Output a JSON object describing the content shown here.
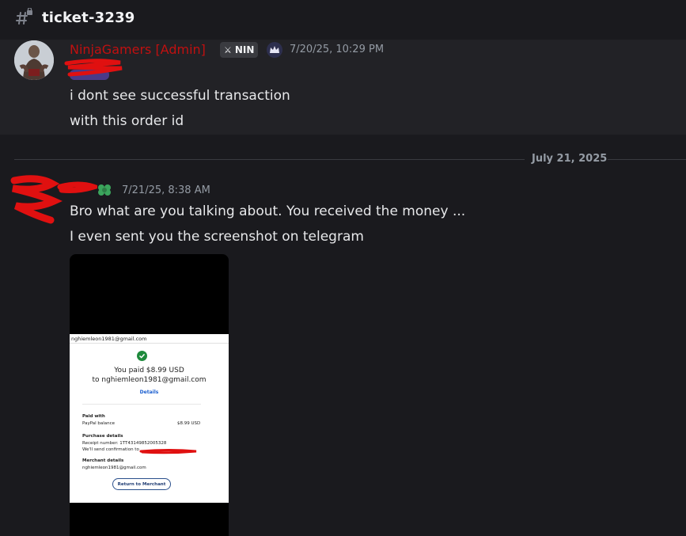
{
  "channel": {
    "name": "ticket-3239"
  },
  "message1": {
    "author": "NinjaGamers [Admin]",
    "tag": "NIN",
    "timestamp": "7/20/25, 10:29 PM",
    "lines": [
      "i dont see successful transaction",
      "with this order id"
    ]
  },
  "divider": {
    "date": "July 21, 2025"
  },
  "message2": {
    "timestamp": "7/21/25, 8:38 AM",
    "lines": [
      "Bro what are you talking about. You received the money ...",
      "I even sent you the screenshot on telegram"
    ]
  },
  "attachment": {
    "email_top": "nghiemleon1981@gmail.com",
    "paid_line": "You paid $8.99 USD",
    "to_line": "to nghiemleon1981@gmail.com",
    "details_link": "Details",
    "paid_with_label": "Paid with",
    "paid_with_method": "PayPal balance",
    "paid_with_amount": "$8.99 USD",
    "purchase_details_label": "Purchase details",
    "receipt_number": "Receipt number: 1TT43149852005328",
    "confirmation": "We'll send confirmation to",
    "merchant_label": "Merchant details",
    "merchant_email": "nghiemleon1981@gmail.com",
    "return_button": "Return to Merchant"
  },
  "icons": {
    "channel": "hash-lock-icon",
    "crown": "crown-icon",
    "clover": "clover-icon",
    "check": "check-circle-icon"
  },
  "colors": {
    "admin_name": "#c01010",
    "redaction": "#e01010",
    "bg": "#1a1a1e",
    "highlight_bg": "#222226"
  }
}
